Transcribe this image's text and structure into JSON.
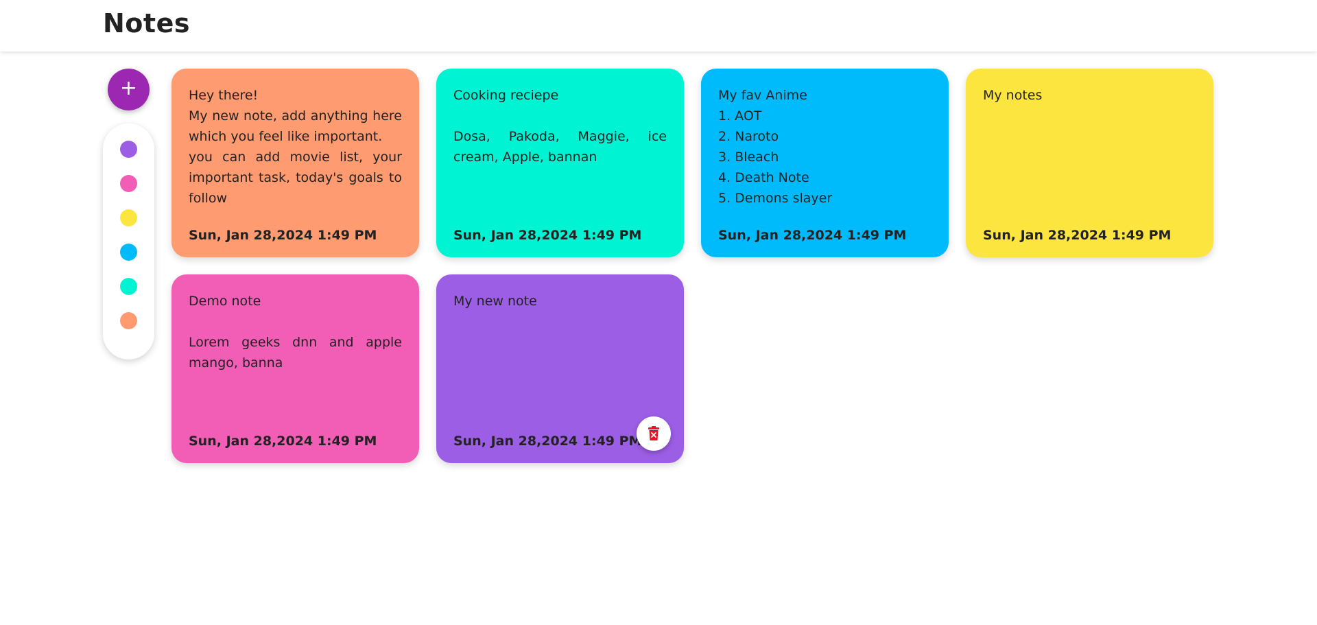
{
  "header": {
    "title": "Notes"
  },
  "sidebar": {
    "add_label": "+",
    "colors": [
      {
        "name": "purple",
        "hex": "#9d5ee6"
      },
      {
        "name": "pink",
        "hex": "#f25db5"
      },
      {
        "name": "yellow",
        "hex": "#fde53f"
      },
      {
        "name": "blue",
        "hex": "#00bbfc"
      },
      {
        "name": "teal",
        "hex": "#00f4d4"
      },
      {
        "name": "orange",
        "hex": "#fe9b71"
      }
    ]
  },
  "notes": [
    {
      "color": "#fe9b71",
      "lines": [
        "Hey there!",
        "My new note, add anything here which you feel like important.",
        "you can add movie list, your important task, today's goals to follow"
      ],
      "date": "Sun, Jan 28,2024 1:49 PM"
    },
    {
      "color": "#00f4d4",
      "lines": [
        "Cooking reciepe",
        "",
        "Dosa, Pakoda, Maggie, ice cream, Apple, bannan"
      ],
      "date": "Sun, Jan 28,2024 1:49 PM"
    },
    {
      "color": "#00bbfc",
      "lines": [
        "My fav Anime",
        "1. AOT",
        "2. Naroto",
        "3. Bleach",
        "4. Death Note",
        "5. Demons slayer"
      ],
      "date": "Sun, Jan 28,2024 1:49 PM"
    },
    {
      "color": "#fde53f",
      "lines": [
        "My notes"
      ],
      "date": "Sun, Jan 28,2024 1:49 PM"
    },
    {
      "color": "#f25db5",
      "lines": [
        "Demo note",
        "",
        "Lorem geeks dnn and apple mango, banna"
      ],
      "date": "Sun, Jan 28,2024 1:49 PM"
    },
    {
      "color": "#9d5ee6",
      "lines": [
        "My new note"
      ],
      "date": "Sun, Jan 28,2024 1:49 PM",
      "delete_icon": "trash-icon",
      "delete_color": "#e8132b"
    }
  ]
}
